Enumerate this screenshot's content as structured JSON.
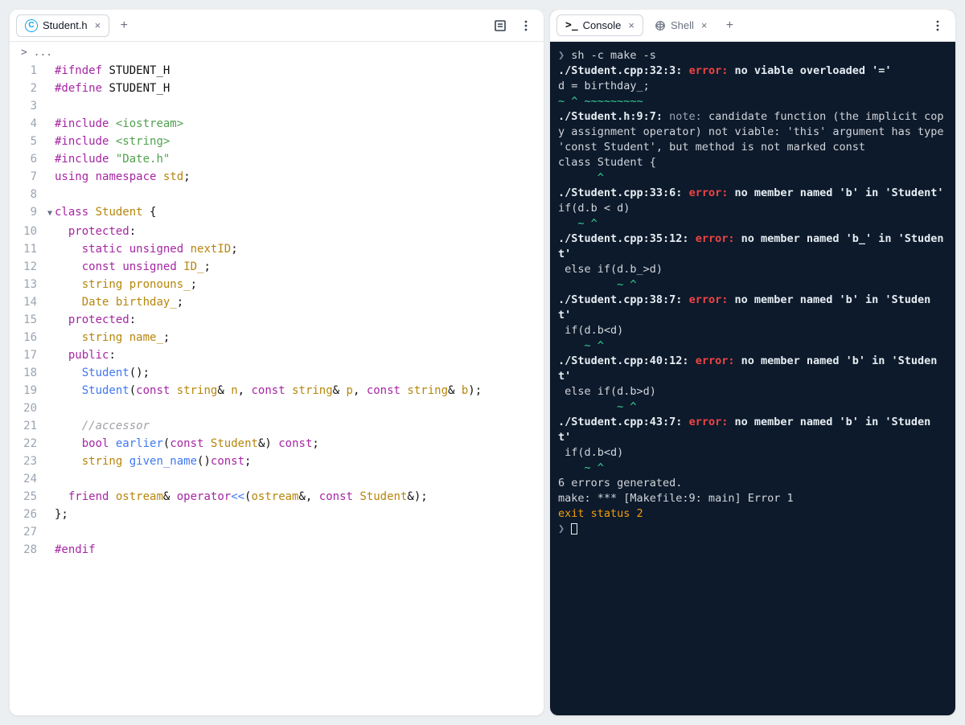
{
  "leftPanel": {
    "tab": {
      "icon": "C",
      "label": "Student.h"
    },
    "breadcrumb": "> ...",
    "lines": [
      {
        "n": 1,
        "tokens": [
          [
            "pp",
            "#ifndef"
          ],
          [
            "plain",
            " "
          ],
          [
            "macro",
            "STUDENT_H"
          ]
        ]
      },
      {
        "n": 2,
        "tokens": [
          [
            "pp",
            "#define"
          ],
          [
            "plain",
            " "
          ],
          [
            "macro",
            "STUDENT_H"
          ]
        ]
      },
      {
        "n": 3,
        "tokens": []
      },
      {
        "n": 4,
        "tokens": [
          [
            "pp",
            "#include"
          ],
          [
            "plain",
            " "
          ],
          [
            "inc",
            "<iostream>"
          ]
        ]
      },
      {
        "n": 5,
        "tokens": [
          [
            "pp",
            "#include"
          ],
          [
            "plain",
            " "
          ],
          [
            "inc",
            "<string>"
          ]
        ]
      },
      {
        "n": 6,
        "tokens": [
          [
            "pp",
            "#include"
          ],
          [
            "plain",
            " "
          ],
          [
            "str",
            "\"Date.h\""
          ]
        ]
      },
      {
        "n": 7,
        "tokens": [
          [
            "kw",
            "using"
          ],
          [
            "plain",
            " "
          ],
          [
            "kw",
            "namespace"
          ],
          [
            "plain",
            " "
          ],
          [
            "id",
            "std"
          ],
          [
            "plain",
            ";"
          ]
        ]
      },
      {
        "n": 8,
        "tokens": []
      },
      {
        "n": 9,
        "fold": true,
        "tokens": [
          [
            "kw",
            "class"
          ],
          [
            "plain",
            " "
          ],
          [
            "cls",
            "Student"
          ],
          [
            "plain",
            " {"
          ]
        ]
      },
      {
        "n": 10,
        "tokens": [
          [
            "plain",
            "  "
          ],
          [
            "kw",
            "protected"
          ],
          [
            "plain",
            ":"
          ]
        ]
      },
      {
        "n": 11,
        "tokens": [
          [
            "plain",
            "    "
          ],
          [
            "kw",
            "static"
          ],
          [
            "plain",
            " "
          ],
          [
            "kw",
            "unsigned"
          ],
          [
            "plain",
            " "
          ],
          [
            "id",
            "nextID"
          ],
          [
            "plain",
            ";"
          ]
        ]
      },
      {
        "n": 12,
        "tokens": [
          [
            "plain",
            "    "
          ],
          [
            "kw",
            "const"
          ],
          [
            "plain",
            " "
          ],
          [
            "kw",
            "unsigned"
          ],
          [
            "plain",
            " "
          ],
          [
            "id",
            "ID_"
          ],
          [
            "plain",
            ";"
          ]
        ]
      },
      {
        "n": 13,
        "tokens": [
          [
            "plain",
            "    "
          ],
          [
            "id",
            "string"
          ],
          [
            "plain",
            " "
          ],
          [
            "id",
            "pronouns_"
          ],
          [
            "plain",
            ";"
          ]
        ]
      },
      {
        "n": 14,
        "tokens": [
          [
            "plain",
            "    "
          ],
          [
            "id",
            "Date"
          ],
          [
            "plain",
            " "
          ],
          [
            "id",
            "birthday_"
          ],
          [
            "plain",
            ";"
          ]
        ]
      },
      {
        "n": 15,
        "tokens": [
          [
            "plain",
            "  "
          ],
          [
            "kw",
            "protected"
          ],
          [
            "plain",
            ":"
          ]
        ]
      },
      {
        "n": 16,
        "tokens": [
          [
            "plain",
            "    "
          ],
          [
            "id",
            "string"
          ],
          [
            "plain",
            " "
          ],
          [
            "id",
            "name_"
          ],
          [
            "plain",
            ";"
          ]
        ]
      },
      {
        "n": 17,
        "tokens": [
          [
            "plain",
            "  "
          ],
          [
            "kw",
            "public"
          ],
          [
            "plain",
            ":"
          ]
        ]
      },
      {
        "n": 18,
        "tokens": [
          [
            "plain",
            "    "
          ],
          [
            "fn",
            "Student"
          ],
          [
            "plain",
            "();"
          ]
        ]
      },
      {
        "n": 19,
        "tokens": [
          [
            "plain",
            "    "
          ],
          [
            "fn",
            "Student"
          ],
          [
            "plain",
            "("
          ],
          [
            "kw",
            "const"
          ],
          [
            "plain",
            " "
          ],
          [
            "id",
            "string"
          ],
          [
            "plain",
            "& "
          ],
          [
            "id",
            "n"
          ],
          [
            "plain",
            ", "
          ],
          [
            "kw",
            "const"
          ],
          [
            "plain",
            " "
          ],
          [
            "id",
            "string"
          ],
          [
            "plain",
            "& "
          ],
          [
            "id",
            "p"
          ],
          [
            "plain",
            ", "
          ],
          [
            "kw",
            "const"
          ],
          [
            "plain",
            " "
          ],
          [
            "id",
            "string"
          ],
          [
            "plain",
            "& "
          ],
          [
            "id",
            "b"
          ],
          [
            "plain",
            ");"
          ]
        ]
      },
      {
        "n": 20,
        "tokens": []
      },
      {
        "n": 21,
        "tokens": [
          [
            "plain",
            "    "
          ],
          [
            "cmt",
            "//accessor"
          ]
        ]
      },
      {
        "n": 22,
        "tokens": [
          [
            "plain",
            "    "
          ],
          [
            "kw",
            "bool"
          ],
          [
            "plain",
            " "
          ],
          [
            "fn",
            "earlier"
          ],
          [
            "plain",
            "("
          ],
          [
            "kw",
            "const"
          ],
          [
            "plain",
            " "
          ],
          [
            "id",
            "Student"
          ],
          [
            "plain",
            "&) "
          ],
          [
            "kw",
            "const"
          ],
          [
            "plain",
            ";"
          ]
        ]
      },
      {
        "n": 23,
        "tokens": [
          [
            "plain",
            "    "
          ],
          [
            "id",
            "string"
          ],
          [
            "plain",
            " "
          ],
          [
            "fn",
            "given_name"
          ],
          [
            "plain",
            "()"
          ],
          [
            "kw",
            "const"
          ],
          [
            "plain",
            ";"
          ]
        ]
      },
      {
        "n": 24,
        "tokens": []
      },
      {
        "n": 25,
        "tokens": [
          [
            "plain",
            "  "
          ],
          [
            "kw",
            "friend"
          ],
          [
            "plain",
            " "
          ],
          [
            "id",
            "ostream"
          ],
          [
            "plain",
            "& "
          ],
          [
            "kw",
            "operator"
          ],
          [
            "fn",
            "<<"
          ],
          [
            "plain",
            "("
          ],
          [
            "id",
            "ostream"
          ],
          [
            "plain",
            "&, "
          ],
          [
            "kw",
            "const"
          ],
          [
            "plain",
            " "
          ],
          [
            "id",
            "Student"
          ],
          [
            "plain",
            "&);"
          ]
        ]
      },
      {
        "n": 26,
        "tokens": [
          [
            "plain",
            "};"
          ]
        ]
      },
      {
        "n": 27,
        "tokens": []
      },
      {
        "n": 28,
        "tokens": [
          [
            "pp",
            "#endif"
          ]
        ]
      }
    ]
  },
  "rightPanel": {
    "tabs": {
      "console": "Console",
      "shell": "Shell"
    },
    "lines": [
      [
        [
          "prompt",
          "❯ "
        ],
        [
          "plain",
          "sh -c make -s"
        ]
      ],
      [
        [
          "white",
          "./Student.cpp:32:3: "
        ],
        [
          "red",
          "error: "
        ],
        [
          "white",
          "no viable overloaded '='"
        ]
      ],
      [
        [
          "plain",
          "d = birthday_;"
        ]
      ],
      [
        [
          "green",
          "~ ^ ~~~~~~~~~"
        ]
      ],
      [
        [
          "white",
          "./Student.h:9:7: "
        ],
        [
          "dim",
          "note: "
        ],
        [
          "plain",
          "candidate function (the implicit copy assignment operator) not viable: 'this' argument has type 'const Student', but method is not marked const"
        ]
      ],
      [
        [
          "plain",
          "class Student {"
        ]
      ],
      [
        [
          "green",
          "      ^"
        ]
      ],
      [
        [
          "white",
          "./Student.cpp:33:6: "
        ],
        [
          "red",
          "error: "
        ],
        [
          "white",
          "no member named 'b' in 'Student'"
        ]
      ],
      [
        [
          "plain",
          "if(d.b < d)"
        ]
      ],
      [
        [
          "green",
          "   ~ ^"
        ]
      ],
      [
        [
          "white",
          "./Student.cpp:35:12: "
        ],
        [
          "red",
          "error: "
        ],
        [
          "white",
          "no member named 'b_' in 'Student'"
        ]
      ],
      [
        [
          "plain",
          " else if(d.b_>d)"
        ]
      ],
      [
        [
          "green",
          "         ~ ^"
        ]
      ],
      [
        [
          "white",
          "./Student.cpp:38:7: "
        ],
        [
          "red",
          "error: "
        ],
        [
          "white",
          "no member named 'b' in 'Studen"
        ]
      ],
      [
        [
          "white",
          "t'"
        ]
      ],
      [
        [
          "plain",
          " if(d.b<d)"
        ]
      ],
      [
        [
          "green",
          "    ~ ^"
        ]
      ],
      [
        [
          "white",
          "./Student.cpp:40:12: "
        ],
        [
          "red",
          "error: "
        ],
        [
          "white",
          "no member named 'b' in 'Student'"
        ]
      ],
      [
        [
          "plain",
          " else if(d.b>d)"
        ]
      ],
      [
        [
          "green",
          "         ~ ^"
        ]
      ],
      [
        [
          "white",
          "./Student.cpp:43:7: "
        ],
        [
          "red",
          "error: "
        ],
        [
          "white",
          "no member named 'b' in 'Studen"
        ]
      ],
      [
        [
          "white",
          "t'"
        ]
      ],
      [
        [
          "plain",
          " if(d.b<d)"
        ]
      ],
      [
        [
          "green",
          "    ~ ^"
        ]
      ],
      [
        [
          "plain",
          "6 errors generated."
        ]
      ],
      [
        [
          "plain",
          "make: *** [Makefile:9: main] Error 1"
        ]
      ],
      [
        [
          "orange",
          "exit status 2"
        ]
      ],
      [
        [
          "prompt",
          "❯ "
        ],
        [
          "cursor",
          ""
        ]
      ]
    ]
  }
}
